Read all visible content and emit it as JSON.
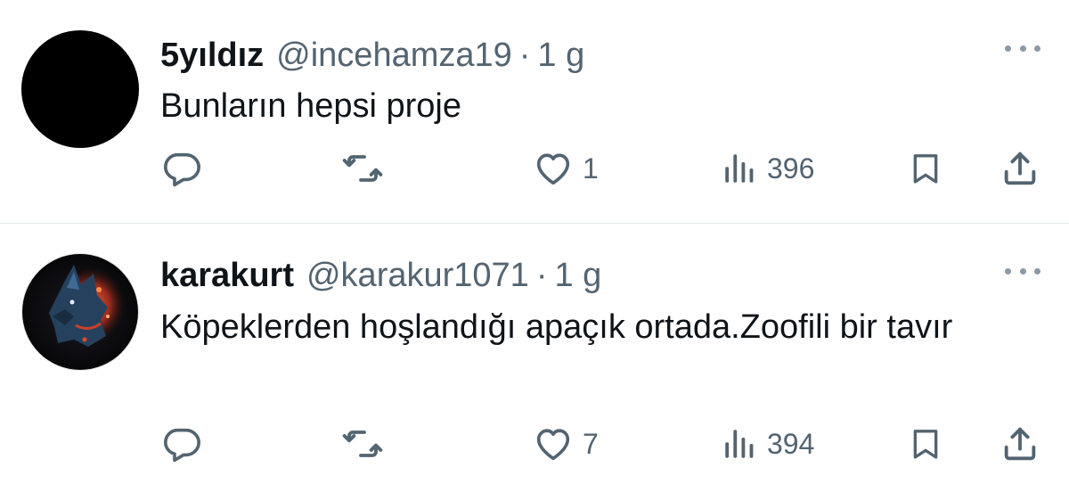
{
  "tweets": [
    {
      "display_name": "5yıldız",
      "handle": "@incehamza19",
      "separator": "·",
      "time": "1 g",
      "text": "Bunların hepsi proje",
      "avatar": "black-circle",
      "likes": "1",
      "views": "396"
    },
    {
      "display_name": "karakurt",
      "handle": "@karakur1071",
      "separator": "·",
      "time": "1 g",
      "text": "Köpeklerden hoşlandığı apaçık ortada.Zoofili bir tavır",
      "avatar": "wolf-avatar",
      "likes": "7",
      "views": "394"
    }
  ],
  "icons": {
    "reply": "reply-icon",
    "retweet": "retweet-icon",
    "like": "heart-icon",
    "views": "views-icon",
    "bookmark": "bookmark-icon",
    "share": "share-icon",
    "more": "more-icon"
  },
  "colors": {
    "text": "#0f1419",
    "secondary": "#536471",
    "divider": "#e6e9ec"
  }
}
